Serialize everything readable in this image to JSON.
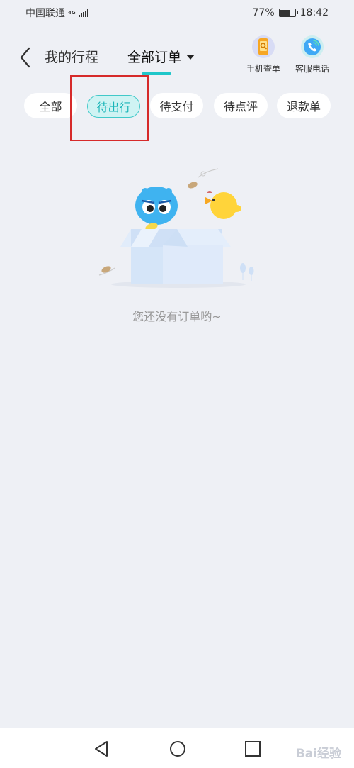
{
  "status_bar": {
    "carrier": "中国联通",
    "network_top": "4G",
    "network_bottom": "",
    "battery_percent": "77%",
    "battery_level": 0.77,
    "time": "18:42"
  },
  "header": {
    "tab_trips": "我的行程",
    "tab_all_orders": "全部订单",
    "tools": [
      {
        "label": "手机查单",
        "icon": "phone-search-icon",
        "color": "#f6a623"
      },
      {
        "label": "客服电话",
        "icon": "customer-service-phone-icon",
        "color": "#3fa9f5"
      }
    ]
  },
  "filters": [
    {
      "label": "全部",
      "active": false
    },
    {
      "label": "待出行",
      "active": true
    },
    {
      "label": "待支付",
      "active": false
    },
    {
      "label": "待点评",
      "active": false
    },
    {
      "label": "退款单",
      "active": false
    }
  ],
  "empty_state": {
    "message": "您还没有订单哟~",
    "illustration": "empty-box-with-mascots-illustration"
  },
  "nav_bar": {
    "icons": [
      "back-triangle-icon",
      "home-circle-icon",
      "recent-square-icon"
    ]
  },
  "watermark": "Bai经验",
  "colors": {
    "accent": "#1fc6c9",
    "highlight_box": "#d62a2a",
    "background": "#eef0f5"
  }
}
